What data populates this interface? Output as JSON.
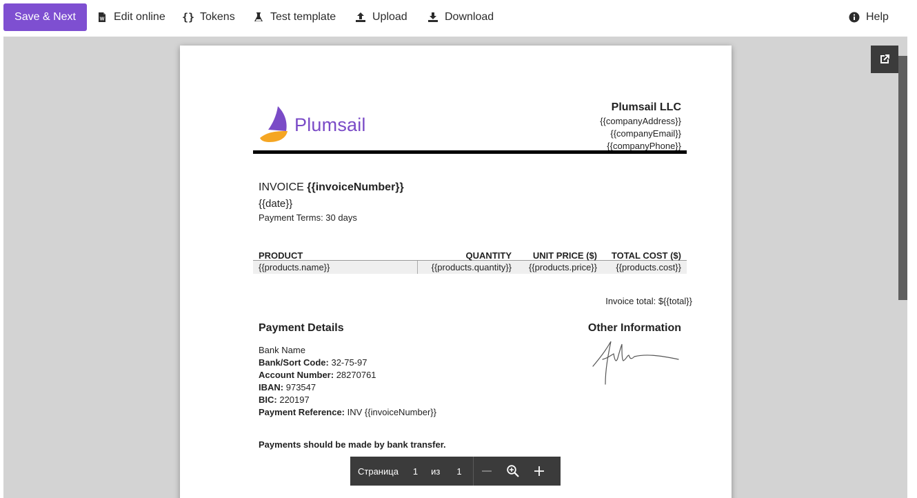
{
  "toolbar": {
    "save_next": "Save & Next",
    "edit_online": "Edit online",
    "tokens": "Tokens",
    "test_template": "Test template",
    "upload": "Upload",
    "download": "Download",
    "help": "Help",
    "accent_color": "#7e4fd1"
  },
  "document": {
    "logo_text": "Plumsail",
    "company_name": "Plumsail LLC",
    "company_address": "{{companyAddress}}",
    "company_email": "{{companyEmail}}",
    "company_phone": "{{companyPhone}}",
    "invoice_label": "INVOICE",
    "invoice_number": "{{invoiceNumber}}",
    "date": "{{date}}",
    "payment_terms": "Payment Terms: 30 days",
    "table": {
      "headers": [
        "PRODUCT",
        "QUANTITY",
        "UNIT PRICE ($)",
        "TOTAL COST ($)"
      ],
      "row": [
        "{{products.name}}",
        "{{products.quantity}}",
        "{{products.price}}",
        "{{products.cost}}"
      ]
    },
    "invoice_total": "Invoice total: ${{total}}",
    "payment_details_title": "Payment Details",
    "other_info_title": "Other Information",
    "bank_name": "Bank Name",
    "bank_sort_code_label": "Bank/Sort Code:",
    "bank_sort_code": "32-75-97",
    "account_number_label": "Account Number:",
    "account_number": "28270761",
    "iban_label": "IBAN:",
    "iban": "973547",
    "bic_label": "BIC:",
    "bic": "220197",
    "payment_reference_label": "Payment Reference:",
    "payment_reference": "INV {{invoiceNumber}}",
    "payment_note": "Payments should be made by bank transfer."
  },
  "pager": {
    "page_label": "Страница",
    "page_current": "1",
    "of_label": "из",
    "page_total": "1"
  }
}
